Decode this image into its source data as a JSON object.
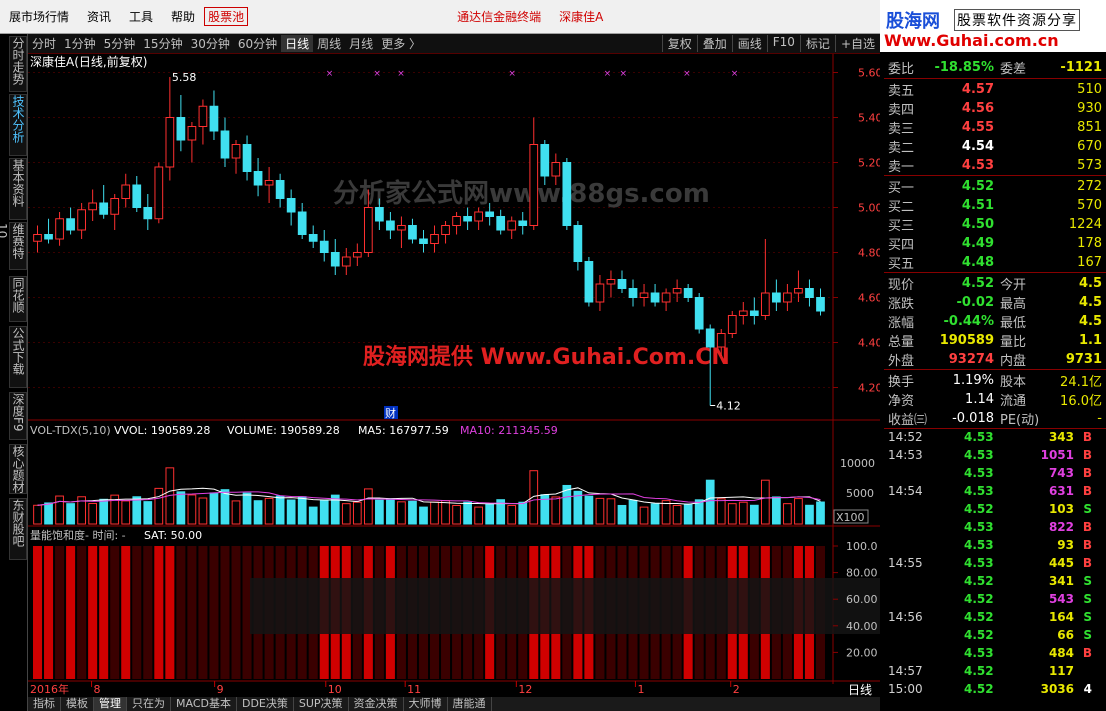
{
  "menu": {
    "items": [
      "展市场行情",
      "资讯",
      "工具",
      "帮助"
    ],
    "stock_pool": "股票池",
    "broker": "通达信金融终端",
    "stock": "深康佳A"
  },
  "brand": {
    "name": "股海网",
    "tag": "股票软件资源分享",
    "url": "Www.Guhai.com.cn"
  },
  "side_tabs": [
    "分时走势",
    "技术分析",
    "基本资料",
    "维赛特10",
    "同花顺",
    "公式下载",
    "深度F9",
    "核心题材",
    "东财股吧"
  ],
  "periods": [
    "分时",
    "1分钟",
    "5分钟",
    "15分钟",
    "30分钟",
    "60分钟",
    "日线",
    "周线",
    "月线",
    "更多 〉"
  ],
  "active_period": "日线",
  "right_tools": [
    "复权",
    "叠加",
    "画线",
    "F10",
    "标记",
    "+自选"
  ],
  "chart": {
    "title": "深康佳A(日线,前复权)",
    "high_label": "5.58",
    "low_label": "4.12",
    "fin_marker": "财",
    "price_axis": [
      "5.60",
      "5.40",
      "5.20",
      "5.00",
      "4.80",
      "4.60",
      "4.40",
      "4.20"
    ],
    "watermark1": "分析家公式网www.88gs.com",
    "watermark2": "股海网提供 Www.Guhai.Com.CN",
    "vol_header": {
      "name": "VOL-TDX(5,10)",
      "vvol": "VVOL: 190589.28",
      "volume": "VOLUME: 190589.28",
      "ma5": "MA5: 167977.59",
      "ma10": "MA10: 211345.59"
    },
    "vol_axis": [
      "10000",
      "5000"
    ],
    "vol_unit": "X100",
    "sat_header": {
      "name": "量能饱和度- 时间: -",
      "sat": "SAT: 50.00"
    },
    "sat_axis": [
      "100.0",
      "80.00",
      "60.00",
      "40.00",
      "20.00"
    ],
    "date_axis": {
      "year": "2016年",
      "months": [
        "8",
        "9",
        "10",
        "11",
        "12",
        "1",
        "2"
      ]
    },
    "period_label": "日线"
  },
  "chart_data": {
    "type": "candlestick",
    "title": "深康佳A(日线,前复权)",
    "ohlc": [
      [
        4.85,
        4.92,
        4.8,
        4.88
      ],
      [
        4.88,
        4.95,
        4.84,
        4.86
      ],
      [
        4.86,
        4.98,
        4.83,
        4.95
      ],
      [
        4.95,
        5.0,
        4.88,
        4.9
      ],
      [
        4.9,
        5.02,
        4.86,
        4.99
      ],
      [
        4.99,
        5.08,
        4.94,
        5.02
      ],
      [
        5.02,
        5.1,
        4.95,
        4.97
      ],
      [
        4.97,
        5.06,
        4.9,
        5.04
      ],
      [
        5.04,
        5.15,
        5.0,
        5.1
      ],
      [
        5.1,
        5.14,
        4.98,
        5.0
      ],
      [
        5.0,
        5.06,
        4.9,
        4.95
      ],
      [
        4.95,
        5.2,
        4.93,
        5.18
      ],
      [
        5.18,
        5.58,
        5.12,
        5.4
      ],
      [
        5.4,
        5.5,
        5.25,
        5.3
      ],
      [
        5.3,
        5.38,
        5.2,
        5.36
      ],
      [
        5.36,
        5.48,
        5.28,
        5.45
      ],
      [
        5.45,
        5.52,
        5.3,
        5.34
      ],
      [
        5.34,
        5.4,
        5.18,
        5.22
      ],
      [
        5.22,
        5.3,
        5.15,
        5.28
      ],
      [
        5.28,
        5.32,
        5.12,
        5.16
      ],
      [
        5.16,
        5.22,
        5.05,
        5.1
      ],
      [
        5.1,
        5.18,
        5.02,
        5.12
      ],
      [
        5.12,
        5.15,
        5.0,
        5.04
      ],
      [
        5.04,
        5.08,
        4.92,
        4.98
      ],
      [
        4.98,
        5.02,
        4.86,
        4.88
      ],
      [
        4.88,
        4.92,
        4.82,
        4.85
      ],
      [
        4.85,
        4.9,
        4.76,
        4.8
      ],
      [
        4.8,
        4.86,
        4.7,
        4.74
      ],
      [
        4.74,
        4.82,
        4.7,
        4.78
      ],
      [
        4.78,
        4.84,
        4.74,
        4.8
      ],
      [
        4.8,
        5.08,
        4.78,
        5.0
      ],
      [
        5.0,
        5.04,
        4.9,
        4.94
      ],
      [
        4.94,
        4.98,
        4.86,
        4.9
      ],
      [
        4.9,
        4.96,
        4.82,
        4.92
      ],
      [
        4.92,
        4.95,
        4.84,
        4.86
      ],
      [
        4.86,
        4.9,
        4.8,
        4.84
      ],
      [
        4.84,
        4.92,
        4.8,
        4.88
      ],
      [
        4.88,
        4.94,
        4.84,
        4.92
      ],
      [
        4.92,
        4.98,
        4.88,
        4.96
      ],
      [
        4.96,
        5.0,
        4.9,
        4.94
      ],
      [
        4.94,
        5.0,
        4.9,
        4.98
      ],
      [
        4.98,
        5.02,
        4.92,
        4.96
      ],
      [
        4.96,
        4.99,
        4.88,
        4.9
      ],
      [
        4.9,
        4.96,
        4.86,
        4.94
      ],
      [
        4.94,
        4.98,
        4.88,
        4.92
      ],
      [
        4.92,
        5.4,
        4.9,
        5.28
      ],
      [
        5.28,
        5.3,
        5.1,
        5.14
      ],
      [
        5.14,
        5.24,
        5.1,
        5.2
      ],
      [
        5.2,
        5.22,
        4.9,
        4.92
      ],
      [
        4.92,
        4.94,
        4.72,
        4.76
      ],
      [
        4.76,
        4.78,
        4.56,
        4.58
      ],
      [
        4.58,
        4.7,
        4.54,
        4.66
      ],
      [
        4.66,
        4.72,
        4.6,
        4.68
      ],
      [
        4.68,
        4.72,
        4.62,
        4.64
      ],
      [
        4.64,
        4.68,
        4.56,
        4.6
      ],
      [
        4.6,
        4.66,
        4.56,
        4.62
      ],
      [
        4.62,
        4.66,
        4.56,
        4.58
      ],
      [
        4.58,
        4.64,
        4.54,
        4.62
      ],
      [
        4.62,
        4.68,
        4.58,
        4.64
      ],
      [
        4.64,
        4.66,
        4.58,
        4.6
      ],
      [
        4.6,
        4.62,
        4.44,
        4.46
      ],
      [
        4.46,
        4.48,
        4.12,
        4.38
      ],
      [
        4.38,
        4.46,
        4.34,
        4.44
      ],
      [
        4.44,
        4.54,
        4.42,
        4.52
      ],
      [
        4.52,
        4.58,
        4.48,
        4.54
      ],
      [
        4.54,
        4.6,
        4.48,
        4.52
      ],
      [
        4.52,
        4.86,
        4.5,
        4.62
      ],
      [
        4.62,
        4.68,
        4.54,
        4.58
      ],
      [
        4.58,
        4.66,
        4.54,
        4.62
      ],
      [
        4.62,
        4.72,
        4.58,
        4.64
      ],
      [
        4.64,
        4.68,
        4.56,
        4.6
      ],
      [
        4.6,
        4.64,
        4.52,
        4.54
      ]
    ],
    "volume_range": [
      0,
      12000
    ],
    "ylim": [
      4.1,
      5.62
    ],
    "sat_bars": [
      1,
      1,
      0,
      1,
      0,
      1,
      1,
      0,
      1,
      0,
      0,
      1,
      1,
      0,
      0,
      0,
      0,
      0,
      0,
      0,
      0,
      0,
      0,
      0,
      0,
      0,
      1,
      1,
      1,
      0,
      1,
      0,
      1,
      0,
      0,
      0,
      0,
      0,
      0,
      0,
      0,
      1,
      0,
      0,
      0,
      1,
      1,
      1,
      0,
      1,
      1,
      0,
      0,
      0,
      0,
      0,
      0,
      0,
      0,
      1,
      0,
      0,
      0,
      1,
      1,
      0,
      1,
      0,
      0,
      1,
      1,
      0
    ]
  },
  "quote": {
    "weibi": {
      "label": "委比",
      "value": "-18.85%",
      "label2": "委差",
      "value2": "-1121"
    },
    "sells": [
      {
        "label": "卖五",
        "price": "4.57",
        "vol": "510"
      },
      {
        "label": "卖四",
        "price": "4.56",
        "vol": "930"
      },
      {
        "label": "卖三",
        "price": "4.55",
        "vol": "851"
      },
      {
        "label": "卖二",
        "price": "4.54",
        "vol": "670"
      },
      {
        "label": "卖一",
        "price": "4.53",
        "vol": "573"
      }
    ],
    "buys": [
      {
        "label": "买一",
        "price": "4.52",
        "vol": "272"
      },
      {
        "label": "买二",
        "price": "4.51",
        "vol": "570"
      },
      {
        "label": "买三",
        "price": "4.50",
        "vol": "1224"
      },
      {
        "label": "买四",
        "price": "4.49",
        "vol": "178"
      },
      {
        "label": "买五",
        "price": "4.48",
        "vol": "167"
      }
    ],
    "stats": [
      {
        "l1": "现价",
        "v1": "4.52",
        "l2": "今开",
        "v2": "4.5"
      },
      {
        "l1": "涨跌",
        "v1": "-0.02",
        "l2": "最高",
        "v2": "4.5"
      },
      {
        "l1": "涨幅",
        "v1": "-0.44%",
        "l2": "最低",
        "v2": "4.5"
      },
      {
        "l1": "总量",
        "v1": "190589",
        "l2": "量比",
        "v2": "1.1"
      },
      {
        "l1": "外盘",
        "v1": "93274",
        "l2": "内盘",
        "v2": "9731"
      }
    ],
    "stats2": [
      {
        "l1": "换手",
        "v1": "1.19%",
        "l2": "股本",
        "v2": "24.1亿"
      },
      {
        "l1": "净资",
        "v1": "1.14",
        "l2": "流通",
        "v2": "16.0亿"
      },
      {
        "l1": "收益㈢",
        "v1": "-0.018",
        "l2": "PE(动)",
        "v2": "-"
      }
    ],
    "ticks": [
      {
        "t": "14:52",
        "p": "4.53",
        "v": "343",
        "bs": "B"
      },
      {
        "t": "14:53",
        "p": "4.53",
        "v": "1051",
        "bs": "B"
      },
      {
        "t": "",
        "p": "4.53",
        "v": "743",
        "bs": "B"
      },
      {
        "t": "14:54",
        "p": "4.53",
        "v": "631",
        "bs": "B"
      },
      {
        "t": "",
        "p": "4.52",
        "v": "103",
        "bs": "S"
      },
      {
        "t": "",
        "p": "4.53",
        "v": "822",
        "bs": "B"
      },
      {
        "t": "",
        "p": "4.53",
        "v": "93",
        "bs": "B"
      },
      {
        "t": "14:55",
        "p": "4.53",
        "v": "445",
        "bs": "B"
      },
      {
        "t": "",
        "p": "4.52",
        "v": "341",
        "bs": "S"
      },
      {
        "t": "",
        "p": "4.52",
        "v": "543",
        "bs": "S"
      },
      {
        "t": "14:56",
        "p": "4.52",
        "v": "164",
        "bs": "S"
      },
      {
        "t": "",
        "p": "4.52",
        "v": "66",
        "bs": "S"
      },
      {
        "t": "",
        "p": "4.53",
        "v": "484",
        "bs": "B"
      },
      {
        "t": "14:57",
        "p": "4.52",
        "v": "117",
        "bs": ""
      },
      {
        "t": "15:00",
        "p": "4.52",
        "v": "3036",
        "bs": "4"
      }
    ]
  },
  "bottom_tabs": [
    "指标",
    "模板",
    "管理",
    "只在为",
    "MACD基本",
    "DDE决策",
    "SUP决策",
    "资金决策",
    "大师博",
    "唐能通"
  ],
  "colors": {
    "up": "#ff3030",
    "down": "#40e0f0",
    "bg": "#000000",
    "grid": "#8a0000",
    "ma5": "#ffffff",
    "ma10": "#e040e0"
  }
}
